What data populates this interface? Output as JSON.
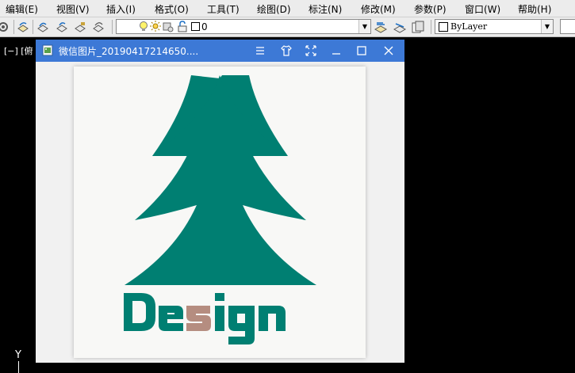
{
  "menu": [
    "编辑(E)",
    "视图(V)",
    "插入(I)",
    "格式(O)",
    "工具(T)",
    "绘图(D)",
    "标注(N)",
    "修改(M)",
    "参数(P)",
    "窗口(W)",
    "帮助(H)"
  ],
  "toolbar": {
    "layer_value": "0",
    "color_value": "ByLayer"
  },
  "drawing": {
    "viewport_label": "[−] [俯",
    "ucs_y": "Y"
  },
  "viewer": {
    "title": "微信图片_20190417214650....",
    "image": {
      "text": "Design",
      "tree_color": "#007f72",
      "accent_color": "#b58d80"
    }
  }
}
